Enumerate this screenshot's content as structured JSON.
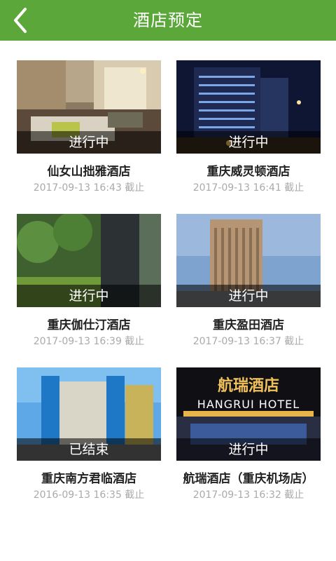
{
  "header": {
    "title": "酒店预定",
    "back_icon": "chevron-left-icon"
  },
  "colors": {
    "header_bg": "#5ba73a"
  },
  "hotels": [
    {
      "name": "仙女山拙雅酒店",
      "status": "进行中",
      "deadline": "2017-09-13 16:43 截止"
    },
    {
      "name": "重庆威灵顿酒店",
      "status": "进行中",
      "deadline": "2017-09-13 16:41 截止"
    },
    {
      "name": "重庆伽仕汀酒店",
      "status": "进行中",
      "deadline": "2017-09-13 16:39 截止"
    },
    {
      "name": "重庆盈田酒店",
      "status": "进行中",
      "deadline": "2017-09-13 16:37 截止"
    },
    {
      "name": "重庆南方君临酒店",
      "status": "已结束",
      "deadline": "2016-09-13 16:35 截止"
    },
    {
      "name": "航瑞酒店（重庆机场店）",
      "status": "进行中",
      "deadline": "2017-09-13 16:32 截止",
      "sign": {
        "cn": "航瑞酒店",
        "en": "HANGRUI HOTEL"
      }
    }
  ]
}
